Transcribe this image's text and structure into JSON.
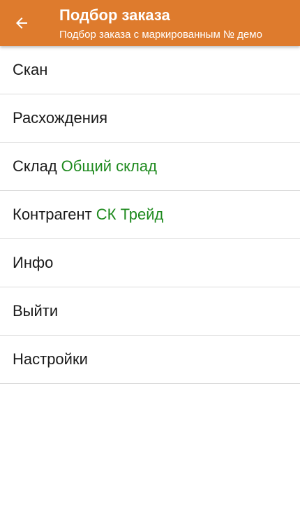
{
  "header": {
    "title": "Подбор заказа",
    "subtitle": "Подбор заказа с маркированным № демо",
    "back_icon": "arrow-left-icon"
  },
  "menu": {
    "scan": "Скан",
    "discrepancies": "Расхождения",
    "warehouse_label": "Склад",
    "warehouse_value": "Общий склад",
    "counterparty_label": "Контрагент",
    "counterparty_value": "СК Трейд",
    "info": "Инфо",
    "exit": "Выйти",
    "settings": "Настройки"
  },
  "colors": {
    "accent": "#de7b2d",
    "value_green": "#1e8a1e"
  }
}
